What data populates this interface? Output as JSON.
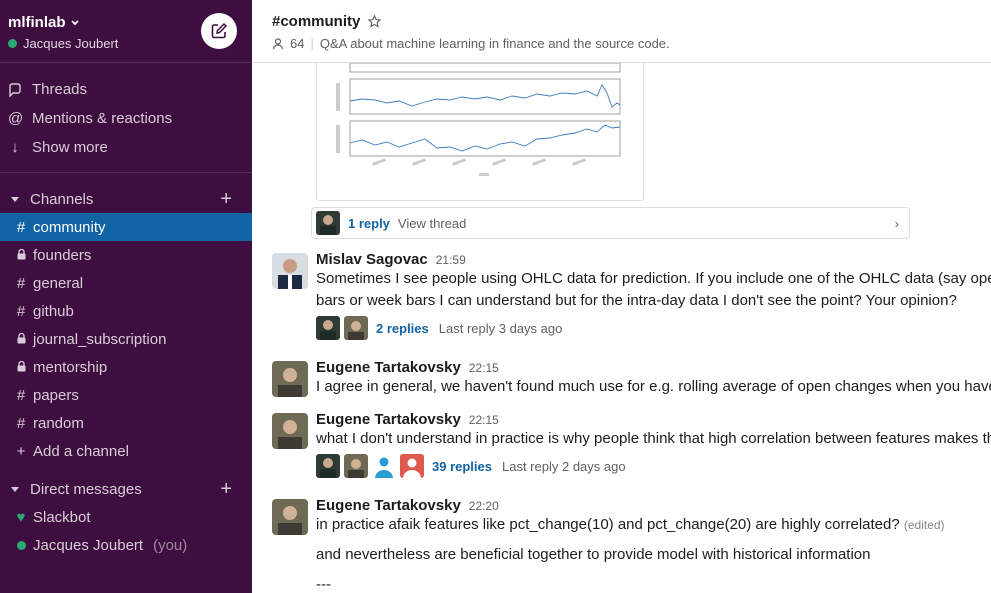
{
  "workspace": {
    "name": "mlfinlab",
    "user": "Jacques Joubert"
  },
  "nav": [
    {
      "label": "Threads",
      "icon": "threads-icon"
    },
    {
      "label": "Mentions & reactions",
      "icon": "at-icon"
    },
    {
      "label": "Show more",
      "icon": "arrow-down-icon"
    }
  ],
  "channels_section": {
    "title": "Channels"
  },
  "channels": [
    {
      "name": "community",
      "prefix": "#",
      "active": true
    },
    {
      "name": "founders",
      "prefix": "lock"
    },
    {
      "name": "general",
      "prefix": "#"
    },
    {
      "name": "github",
      "prefix": "#"
    },
    {
      "name": "journal_subscription",
      "prefix": "lock"
    },
    {
      "name": "mentorship",
      "prefix": "lock"
    },
    {
      "name": "papers",
      "prefix": "#"
    },
    {
      "name": "random",
      "prefix": "#"
    }
  ],
  "add_channel": "Add a channel",
  "dm_section": {
    "title": "Direct messages"
  },
  "dms": [
    {
      "name": "Slackbot",
      "status": "heart"
    },
    {
      "name": "Jacques Joubert",
      "suffix": "(you)",
      "status": "online"
    }
  ],
  "channel": {
    "title": "#community",
    "members": "64",
    "topic": "Q&A about machine learning in finance and the source code."
  },
  "thread_bar": {
    "replies": "1 reply",
    "action": "View thread"
  },
  "messages": [
    {
      "author": "Mislav Sagovac",
      "time": "21:59",
      "lines": [
        "Sometimes I see people using OHLC data for prediction. If you include one of the OHLC data (say open)",
        "bars or week bars I can understand but for the intra-day data I don't see the point? Your opinion?"
      ],
      "replies": "2 replies",
      "last_reply": "Last reply 3 days ago"
    },
    {
      "author": "Eugene Tartakovsky",
      "time": "22:15",
      "lines": [
        "I agree in general, we haven't found much use for e.g. rolling average of open changes when you have ro"
      ]
    },
    {
      "author": "Eugene Tartakovsky",
      "time": "22:15",
      "lines": [
        "what I don't understand in practice is why people think that high correlation between features makes th"
      ],
      "replies": "39 replies",
      "last_reply": "Last reply 2 days ago"
    },
    {
      "author": "Eugene Tartakovsky",
      "time": "22:20",
      "lines": [
        "in practice afaik features like pct_change(10) and pct_change(20) are highly correlated?",
        "and nevertheless are beneficial together to provide model with historical information",
        "---"
      ],
      "edited": "(edited)"
    }
  ],
  "colors": {
    "sidebar": "#3f0e40",
    "active": "#1164a3",
    "link": "#1264a3",
    "online": "#2bac76"
  }
}
